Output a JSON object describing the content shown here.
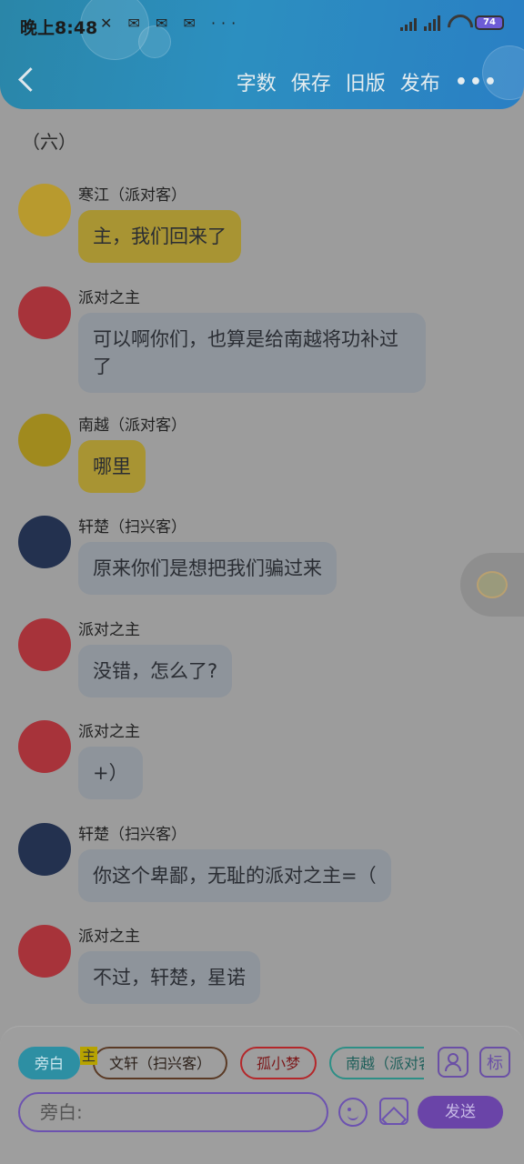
{
  "status_bar": {
    "time": "晚上8:48",
    "notif_icons": "✕ ✉ ✉ ✉ ···",
    "battery": "74"
  },
  "nav": {
    "back_icon": "chevron-left-icon",
    "actions": [
      "字数",
      "保存",
      "旧版",
      "发布"
    ],
    "more": "•••"
  },
  "chapter_title": "（六）",
  "messages": [
    {
      "name": "寒江（派对客）",
      "text": "主，我们回来了",
      "style": "yellow",
      "avatar_color": "#b89a2e"
    },
    {
      "name": "派对之主",
      "text": "可以啊你们，也算是给南越将功补过了",
      "style": "gray",
      "avatar_color": "#a7333a"
    },
    {
      "name": "南越（派对客）",
      "text": "哪里",
      "style": "yellow",
      "avatar_color": "#a08a1e"
    },
    {
      "name": "轩楚（扫兴客）",
      "text": "原来你们是想把我们骗过来",
      "style": "gray",
      "avatar_color": "#23314f"
    },
    {
      "name": "派对之主",
      "text": "没错，怎么了?",
      "style": "gray",
      "avatar_color": "#a7333a"
    },
    {
      "name": "派对之主",
      "text": "+）",
      "style": "gray",
      "avatar_color": "#a7333a"
    },
    {
      "name": "轩楚（扫兴客）",
      "text": "你这个卑鄙，无耻的派对之主=（",
      "style": "gray",
      "avatar_color": "#23314f"
    },
    {
      "name": "派对之主",
      "text": "不过，轩楚，星诺",
      "style": "gray",
      "avatar_color": "#a7333a"
    }
  ],
  "composer": {
    "chips": [
      "旁白",
      "文轩（扫兴客）",
      "孤小梦",
      "南越（派对客）"
    ],
    "zhu_badge": "主",
    "profile_icon": "person-icon",
    "tag_button": "标",
    "input_placeholder": "旁白:",
    "send_label": "发送"
  }
}
